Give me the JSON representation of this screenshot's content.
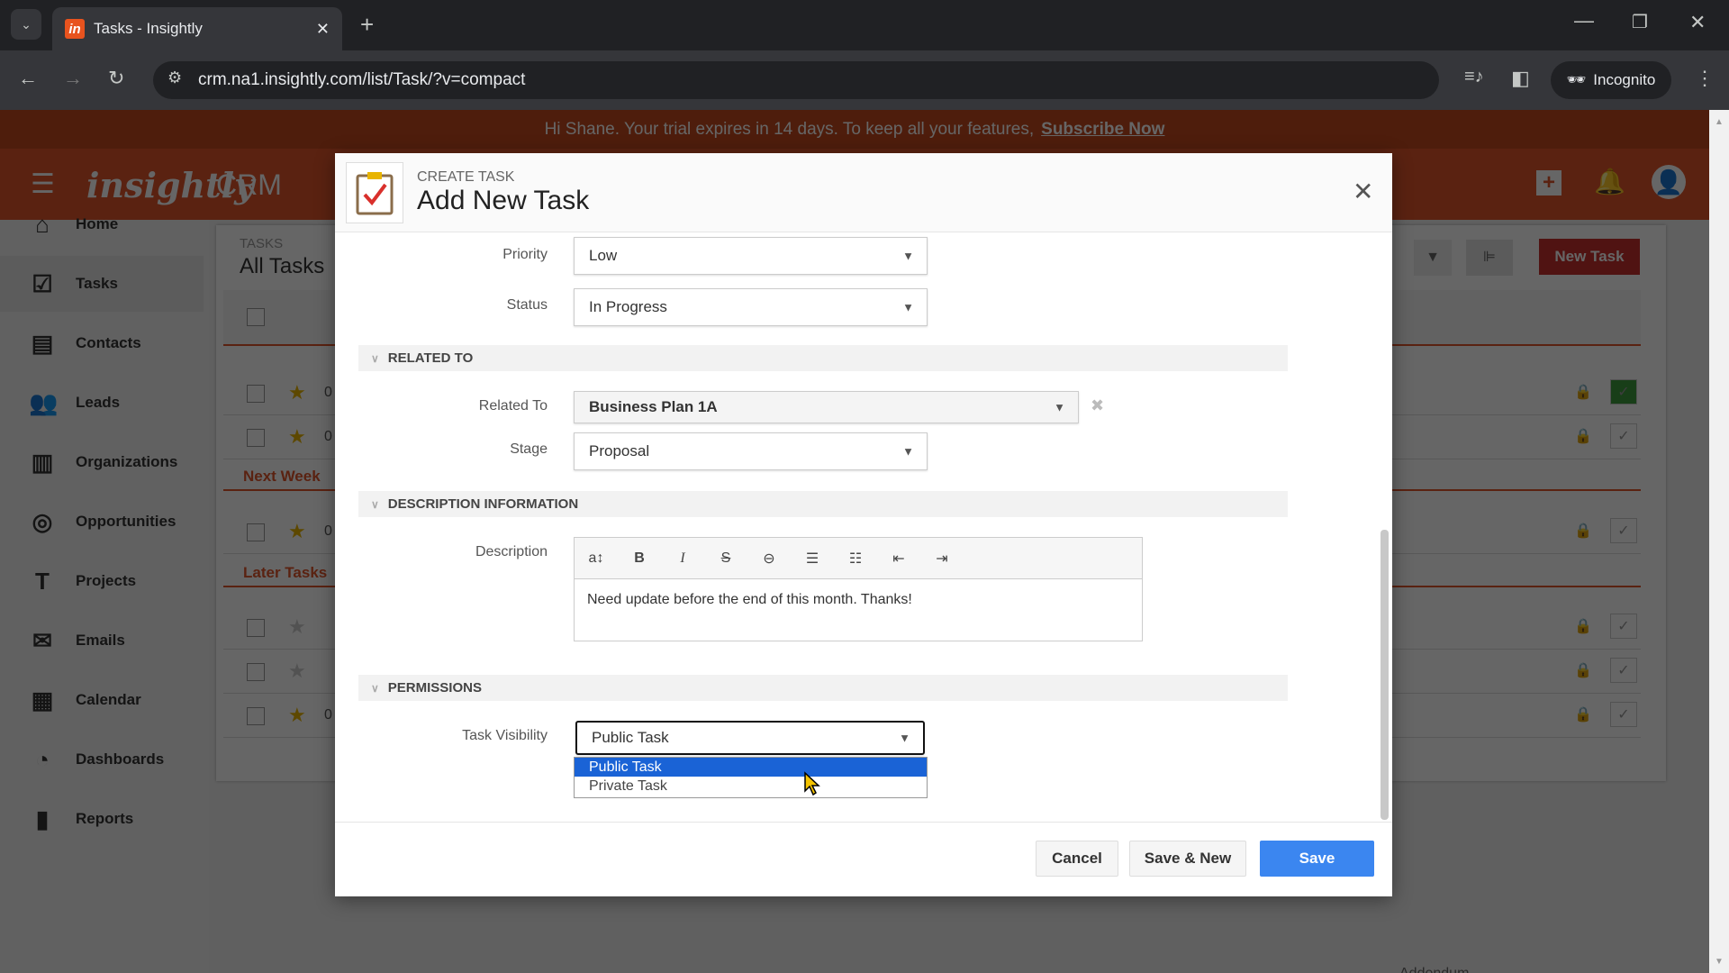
{
  "browser": {
    "tab_title": "Tasks - Insightly",
    "url": "crm.na1.insightly.com/list/Task/?v=compact",
    "incognito_label": "Incognito"
  },
  "banner": {
    "text": "Hi Shane. Your trial expires in 14 days. To keep all your features,",
    "link": "Subscribe Now"
  },
  "header": {
    "logo": "insightly",
    "product": "CRM"
  },
  "sidebar": {
    "items": [
      {
        "label": "Home",
        "icon": "home-icon"
      },
      {
        "label": "Tasks",
        "icon": "tasks-icon"
      },
      {
        "label": "Contacts",
        "icon": "contacts-icon"
      },
      {
        "label": "Leads",
        "icon": "leads-icon"
      },
      {
        "label": "Organizations",
        "icon": "organizations-icon"
      },
      {
        "label": "Opportunities",
        "icon": "opportunities-icon"
      },
      {
        "label": "Projects",
        "icon": "projects-icon"
      },
      {
        "label": "Emails",
        "icon": "emails-icon"
      },
      {
        "label": "Calendar",
        "icon": "calendar-icon"
      },
      {
        "label": "Dashboards",
        "icon": "dashboards-icon"
      },
      {
        "label": "Reports",
        "icon": "reports-icon"
      }
    ]
  },
  "list": {
    "breadcrumb": "TASKS",
    "title": "All Tasks",
    "new_task": "New Task",
    "sections": [
      "Next Week",
      "Later Tasks"
    ],
    "row_prefix": "0",
    "addendum": "Addendum"
  },
  "modal": {
    "eyebrow": "CREATE TASK",
    "title": "Add New Task",
    "priority": {
      "label": "Priority",
      "value": "Low"
    },
    "status": {
      "label": "Status",
      "value": "In Progress"
    },
    "related_section": "RELATED TO",
    "related_to": {
      "label": "Related To",
      "value": "Business Plan 1A"
    },
    "stage": {
      "label": "Stage",
      "value": "Proposal"
    },
    "description_section": "DESCRIPTION INFORMATION",
    "description": {
      "label": "Description",
      "value": "Need update before the end of this month. Thanks!"
    },
    "permissions_section": "PERMISSIONS",
    "visibility": {
      "label": "Task Visibility",
      "value": "Public Task",
      "options": [
        "Public Task",
        "Private Task"
      ],
      "highlighted": "Public Task"
    },
    "buttons": {
      "cancel": "Cancel",
      "save_new": "Save & New",
      "save": "Save"
    }
  },
  "colors": {
    "brand": "#e0552a",
    "primary": "#3b86f0",
    "highlight": "#1a63d6"
  }
}
